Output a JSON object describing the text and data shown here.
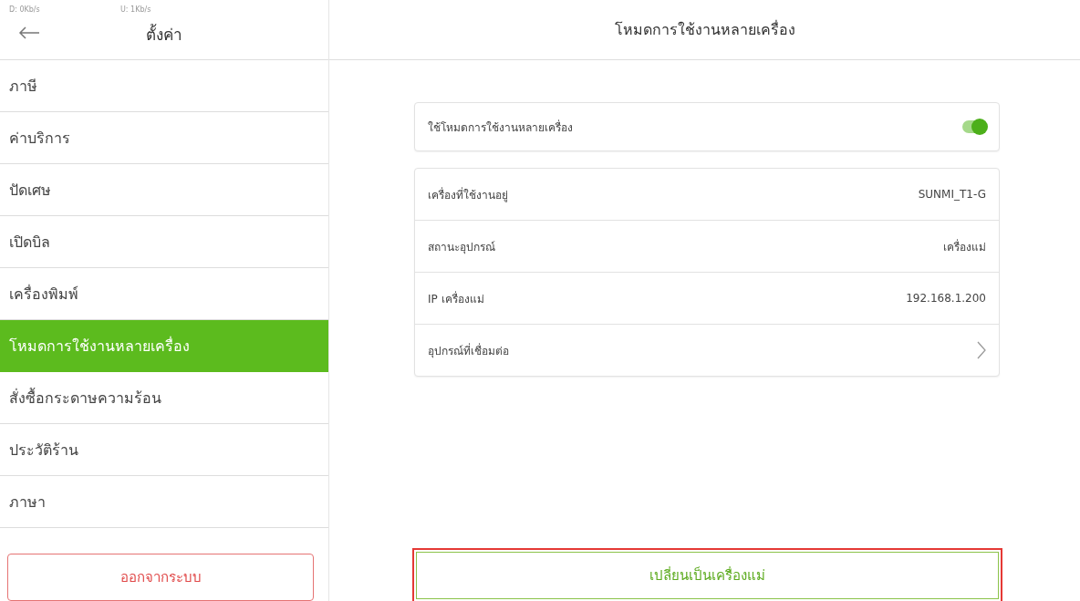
{
  "status_bar": {
    "download": "D: 0Kb/s",
    "upload": "U: 1Kb/s"
  },
  "sidebar": {
    "title": "ตั้งค่า",
    "items": [
      {
        "label": "ภาษี",
        "selected": false
      },
      {
        "label": "ค่าบริการ",
        "selected": false
      },
      {
        "label": "ปัดเศษ",
        "selected": false
      },
      {
        "label": "เปิดบิล",
        "selected": false
      },
      {
        "label": "เครื่องพิมพ์",
        "selected": false
      },
      {
        "label": "โหมดการใช้งานหลายเครื่อง",
        "selected": true
      },
      {
        "label": "สั่งซื้อกระดาษความร้อน",
        "selected": false
      },
      {
        "label": "ประวัติร้าน",
        "selected": false
      },
      {
        "label": "ภาษา",
        "selected": false
      }
    ],
    "logout_button": "ออกจากระบบ"
  },
  "main": {
    "title": "โหมดการใช้งานหลายเครื่อง",
    "toggle": {
      "label": "ใช้โหมดการใช้งานหลายเครื่อง",
      "on": true
    },
    "rows": [
      {
        "kind": "value",
        "label": "เครื่องที่ใช้งานอยู่",
        "value": "SUNMI_T1-G"
      },
      {
        "kind": "value",
        "label": "สถานะอุปกรณ์",
        "value": "เครื่องแม่"
      },
      {
        "kind": "value",
        "label": "IP เครื่องแม่",
        "value": "192.168.1.200"
      },
      {
        "kind": "link",
        "label": "อุปกรณ์ที่เชื่อมต่อ"
      }
    ],
    "action_button": {
      "label": "เปลี่ยนเป็นเครื่องแม่",
      "highlighted": true
    }
  }
}
